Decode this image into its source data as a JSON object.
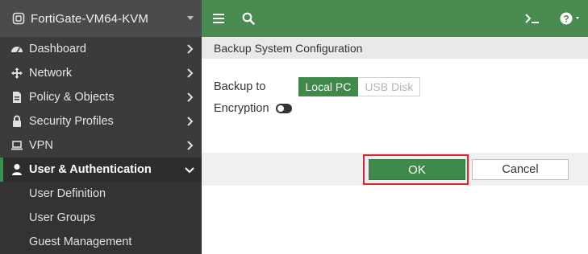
{
  "sidebar": {
    "device_title": "FortiGate-VM64-KVM",
    "items": [
      {
        "label": "Dashboard",
        "icon": "dashboard-icon"
      },
      {
        "label": "Network",
        "icon": "network-icon"
      },
      {
        "label": "Policy & Objects",
        "icon": "policy-icon"
      },
      {
        "label": "Security Profiles",
        "icon": "lock-icon"
      },
      {
        "label": "VPN",
        "icon": "laptop-icon"
      },
      {
        "label": "User & Authentication",
        "icon": "user-icon"
      }
    ],
    "subitems": [
      {
        "label": "User Definition"
      },
      {
        "label": "User Groups"
      },
      {
        "label": "Guest Management"
      }
    ]
  },
  "topbar": {
    "icons": [
      "menu-icon",
      "search-icon",
      "terminal-icon",
      "help-icon"
    ]
  },
  "panel": {
    "title": "Backup System Configuration",
    "backup_to_label": "Backup to",
    "options": [
      "Local PC",
      "USB Disk"
    ],
    "selected_option": "Local PC",
    "encryption_label": "Encryption",
    "encryption_enabled": false,
    "ok_label": "OK",
    "cancel_label": "Cancel"
  },
  "colors": {
    "accent_green": "#4a8b51",
    "sidebar_bg": "#3b3b3b",
    "highlight_red": "#d9252c"
  }
}
